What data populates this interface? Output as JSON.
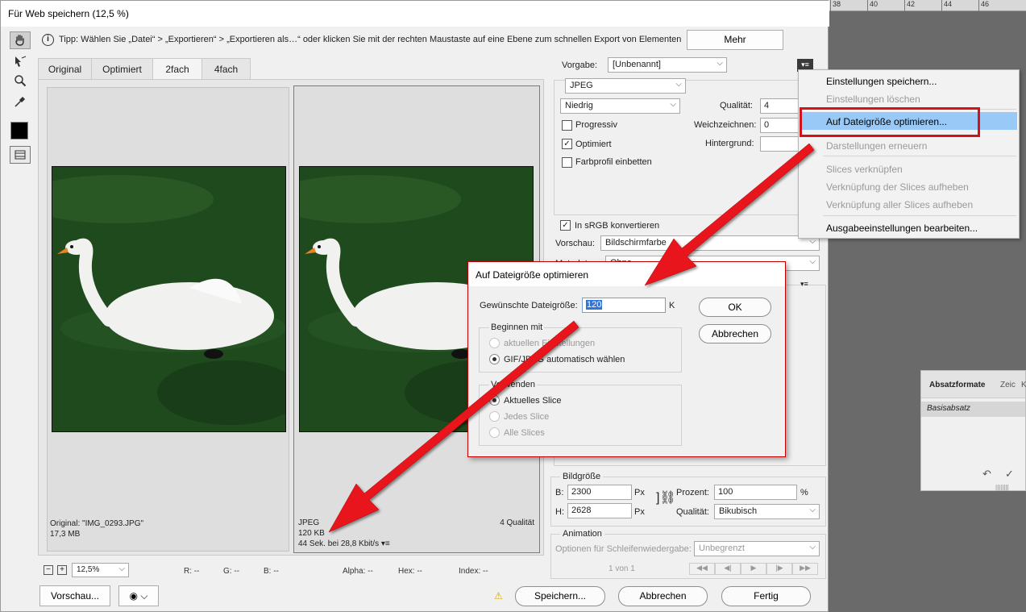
{
  "window": {
    "title": "Für Web speichern (12,5 %)"
  },
  "ruler": {
    "ticks": [
      "38",
      "40",
      "42",
      "44",
      "46"
    ]
  },
  "tip": {
    "text": "Tipp: Wählen Sie „Datei“ > „Exportieren“ > „Exportieren als…“ oder klicken Sie mit der rechten Maustaste auf eine Ebene zum schnellen Export von Elementen",
    "more_label": "Mehr"
  },
  "tabs": [
    "Original",
    "Optimiert",
    "2fach",
    "4fach"
  ],
  "active_tab": "2fach",
  "panes": {
    "original": {
      "line1": "Original: \"IMG_0293.JPG\"",
      "line2": "17,3 MB"
    },
    "optimized": {
      "format": "JPEG",
      "size": "120 KB",
      "time": "44 Sek. bei 28,8 Kbit/s",
      "quality": "4 Qualität"
    }
  },
  "settings": {
    "preset_label": "Vorgabe:",
    "preset_value": "[Unbenannt]",
    "format_value": "JPEG",
    "quality_level": "Niedrig",
    "quality_label": "Qualität:",
    "quality_value": "4",
    "blur_label": "Weichzeichnen:",
    "blur_value": "0",
    "matte_label": "Hintergrund:",
    "progressive_label": "Progressiv",
    "optimized_label": "Optimiert",
    "embed_profile_label": "Farbprofil einbetten",
    "srgb_label": "In sRGB konvertieren",
    "preview_label": "Vorschau:",
    "preview_value": "Bildschirmfarbe",
    "metadata_label": "Metadaten:",
    "metadata_value": "Ohne"
  },
  "image_size": {
    "group_label": "Bildgröße",
    "w_label": "B:",
    "w_value": "2300",
    "w_unit": "Px",
    "h_label": "H:",
    "h_value": "2628",
    "h_unit": "Px",
    "percent_label": "Prozent:",
    "percent_value": "100",
    "percent_unit": "%",
    "quality_label": "Qualität:",
    "quality_value": "Bikubisch"
  },
  "animation": {
    "group_label": "Animation",
    "loop_label": "Optionen für Schleifenwiedergabe:",
    "loop_value": "Unbegrenzt",
    "frame_counter": "1 von 1"
  },
  "menu": {
    "items": [
      "Einstellungen speichern...",
      "Einstellungen löschen",
      "Auf Dateigröße optimieren...",
      "Darstellungen erneuern",
      "Slices verknüpfen",
      "Verknüpfung der Slices aufheben",
      "Verknüpfung aller Slices aufheben",
      "Ausgabeeinstellungen bearbeiten..."
    ]
  },
  "modal": {
    "title": "Auf Dateigröße optimieren",
    "size_label": "Gewünschte Dateigröße:",
    "size_value": "120",
    "size_unit": "K",
    "ok_label": "OK",
    "cancel_label": "Abbrechen",
    "start_group": "Beginnen mit",
    "start_opt1": "aktuellen Einstellungen",
    "start_opt2": "GIF/JPEG automatisch wählen",
    "use_group": "Verwenden",
    "use_opt1": "Aktuelles Slice",
    "use_opt2": "Jedes Slice",
    "use_opt3": "Alle Slices"
  },
  "absatz": {
    "tab1": "Absatzformate",
    "tab2": "Zeic",
    "tab3": "K",
    "item": "Basisabsatz"
  },
  "status": {
    "zoom": "12,5%",
    "r": "R: --",
    "g": "G: --",
    "b": "B: --",
    "alpha": "Alpha: --",
    "hex": "Hex: --",
    "index": "Index: --"
  },
  "footer": {
    "preview_label": "Vorschau...",
    "save_label": "Speichern...",
    "cancel_label": "Abbrechen",
    "done_label": "Fertig"
  },
  "colors": {
    "highlight": "#99c9f7",
    "arrow": "#e8141a",
    "photo_bg": "#1f4a1e"
  }
}
